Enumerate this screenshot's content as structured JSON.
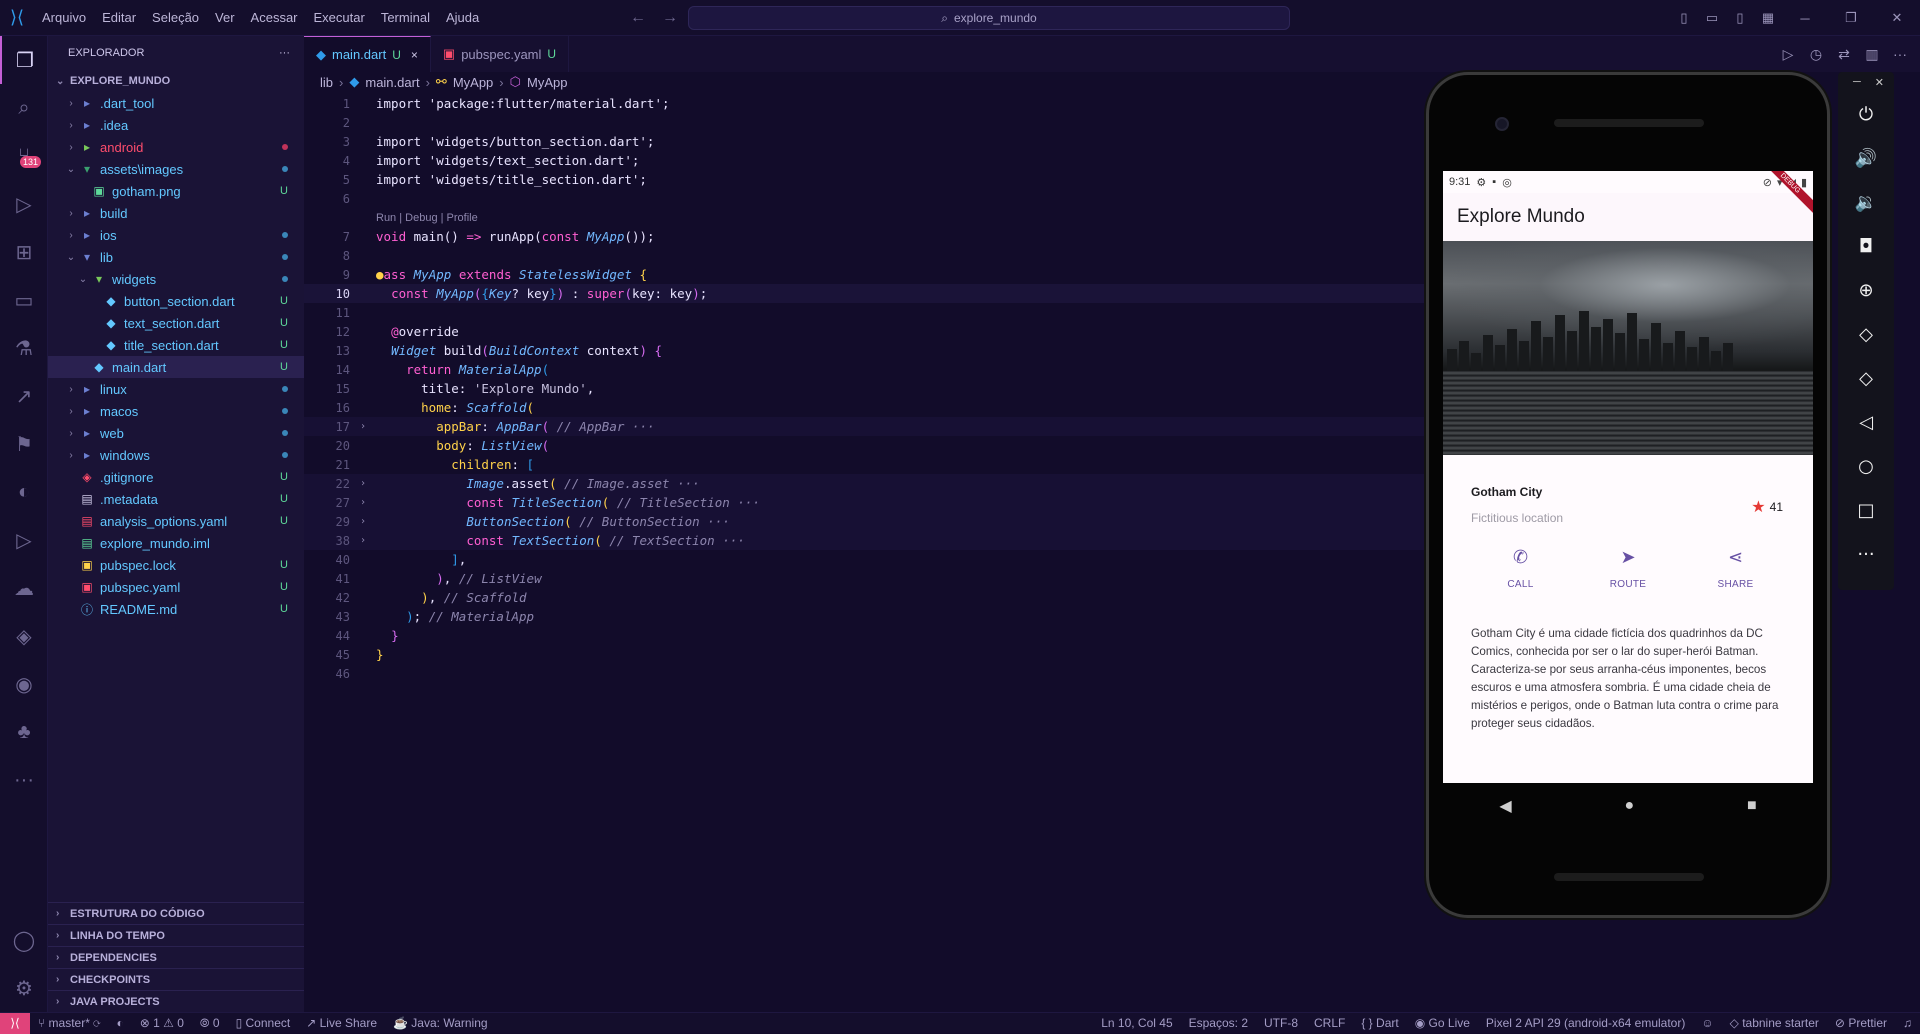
{
  "menu": {
    "items": [
      "Arquivo",
      "Editar",
      "Seleção",
      "Ver",
      "Acessar",
      "Executar",
      "Terminal",
      "Ajuda"
    ]
  },
  "command_center": {
    "text": "explore_mundo"
  },
  "activity": {
    "scm_badge": "131"
  },
  "explorer": {
    "title": "EXPLORADOR",
    "more": "···",
    "project": "EXPLORE_MUNDO",
    "items": [
      {
        "label": ".dart_tool",
        "status": ""
      },
      {
        "label": ".idea",
        "status": ""
      },
      {
        "label": "android",
        "status": ""
      },
      {
        "label": "assets\\images",
        "status": ""
      },
      {
        "label": "gotham.png",
        "status": "U"
      },
      {
        "label": "build",
        "status": ""
      },
      {
        "label": "ios",
        "status": ""
      },
      {
        "label": "lib",
        "status": ""
      },
      {
        "label": "widgets",
        "status": ""
      },
      {
        "label": "button_section.dart",
        "status": "U"
      },
      {
        "label": "text_section.dart",
        "status": "U"
      },
      {
        "label": "title_section.dart",
        "status": "U"
      },
      {
        "label": "main.dart",
        "status": "U"
      },
      {
        "label": "linux",
        "status": ""
      },
      {
        "label": "macos",
        "status": ""
      },
      {
        "label": "web",
        "status": ""
      },
      {
        "label": "windows",
        "status": ""
      },
      {
        "label": ".gitignore",
        "status": "U"
      },
      {
        "label": ".metadata",
        "status": "U"
      },
      {
        "label": "analysis_options.yaml",
        "status": "U"
      },
      {
        "label": "explore_mundo.iml",
        "status": ""
      },
      {
        "label": "pubspec.lock",
        "status": "U"
      },
      {
        "label": "pubspec.yaml",
        "status": "U"
      },
      {
        "label": "README.md",
        "status": "U"
      }
    ],
    "sections": [
      "ESTRUTURA DO CÓDIGO",
      "LINHA DO TEMPO",
      "DEPENDENCIES",
      "CHECKPOINTS",
      "JAVA PROJECTS"
    ]
  },
  "tabs": [
    {
      "label": "main.dart",
      "status": "U",
      "close": "×"
    },
    {
      "label": "pubspec.yaml",
      "status": "U"
    }
  ],
  "breadcrumbs": {
    "folder": "lib",
    "file": "main.dart",
    "class1": "MyApp",
    "class2": "MyApp"
  },
  "code": {
    "line_numbers": [
      "1",
      "2",
      "3",
      "4",
      "5",
      "6",
      "7",
      "8",
      "9",
      "10",
      "11",
      "12",
      "13",
      "14",
      "15",
      "16",
      "17",
      "20",
      "21",
      "22",
      "27",
      "29",
      "38",
      "40",
      "41",
      "42",
      "43",
      "44",
      "45",
      "46"
    ],
    "codelens": "Run | Debug | Profile",
    "l1": "import 'package:flutter/material.dart';",
    "l3": "import 'widgets/button_section.dart';",
    "l4": "import 'widgets/text_section.dart';",
    "l5": "import 'widgets/title_section.dart';",
    "l15_comment": "'Explore Mundo'",
    "c_appbar": "// AppBar",
    "c_image": "// Image.asset",
    "c_title": "// TitleSection",
    "c_button": "// ButtonSection",
    "c_text": "// TextSection",
    "c_listview": "// ListView",
    "c_scaffold": "// Scaffold",
    "c_materialapp": "// MaterialApp",
    "ellipsis": "···"
  },
  "phone": {
    "time": "9:31",
    "debug": "DEBUG",
    "app_title": "Explore Mundo",
    "place_title": "Gotham City",
    "place_sub": "Fictitious location",
    "star_count": "41",
    "buttons": [
      {
        "label": "CALL",
        "icon": "phone-icon"
      },
      {
        "label": "ROUTE",
        "icon": "navigation-icon"
      },
      {
        "label": "SHARE",
        "icon": "share-icon"
      }
    ],
    "description": "Gotham City é uma cidade fictícia dos quadrinhos da DC Comics, conhecida por ser o lar do super-herói Batman. Caracteriza-se por seus arranha-céus imponentes, becos escuros e uma atmosfera sombria. É uma cidade cheia de mistérios e perigos, onde o Batman luta contra o crime para proteger seus cidadãos."
  },
  "statusbar": {
    "branch": "master*",
    "errors": "1",
    "warnings": "0",
    "ports": "0",
    "connect": "Connect",
    "liveshare": "Live Share",
    "java": "Java: Warning",
    "position": "Ln 10, Col 45",
    "spaces": "Espaços: 2",
    "encoding": "UTF-8",
    "eol": "CRLF",
    "language": "Dart",
    "golive": "Go Live",
    "device": "Pixel 2 API 29 (android-x64 emulator)",
    "tabnine": "tabnine starter",
    "prettier": "Prettier"
  },
  "colors": {
    "accent": "#c45fd6",
    "keyword": "#ff5fd2",
    "type": "#72b8ff",
    "untracked": "#5ed99a",
    "error_badge": "#e0437a"
  }
}
